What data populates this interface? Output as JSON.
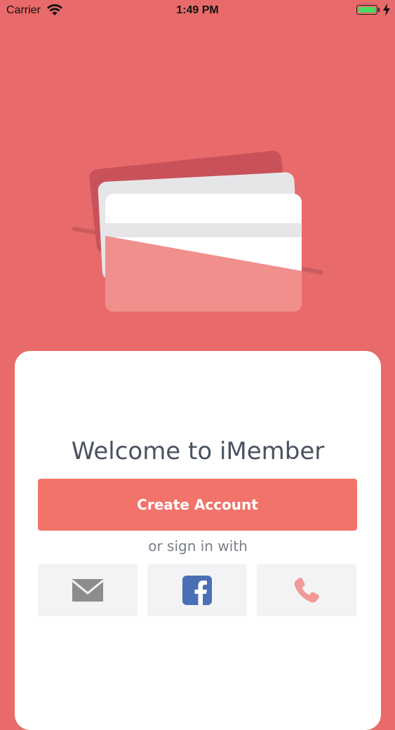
{
  "status_bar": {
    "carrier": "Carrier",
    "time": "1:49 PM",
    "icons": [
      "wifi-icon",
      "battery-icon",
      "charging-bolt-icon"
    ]
  },
  "illustration": {
    "name": "stacked-cards-illustration"
  },
  "welcome": {
    "title": "Welcome to iMember",
    "create_account_label": "Create Account",
    "or_sign_in_with": "or sign in with"
  },
  "sign_in_options": [
    {
      "name": "email-sign-in-button",
      "icon": "envelope-icon"
    },
    {
      "name": "facebook-sign-in-button",
      "icon": "facebook-icon"
    },
    {
      "name": "phone-sign-in-button",
      "icon": "phone-icon"
    }
  ],
  "colors": {
    "background": "#e96a6a",
    "button": "#f2736a",
    "tile": "#f3f3f5",
    "facebook": "#4a6fb5",
    "phone": "#f19a98",
    "mail": "#8d8d8d"
  }
}
